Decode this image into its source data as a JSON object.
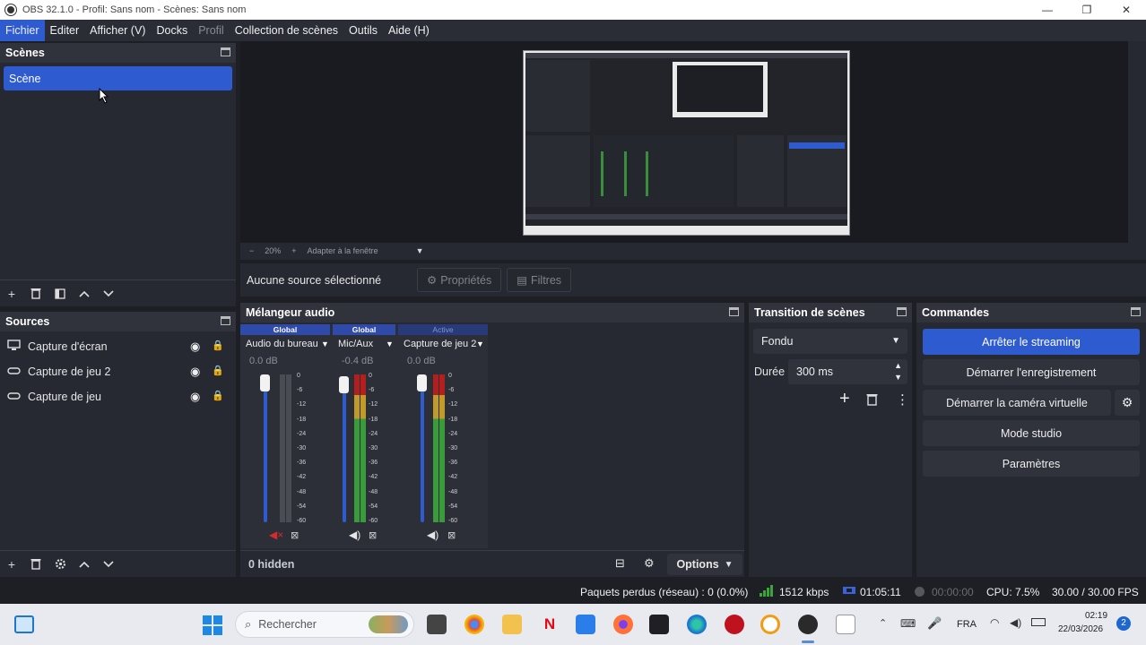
{
  "window": {
    "title": "OBS 32.1.0 - Profil: Sans nom - Scènes: Sans nom",
    "minimize": "—",
    "maximize": "❐",
    "close": "✕"
  },
  "menu": [
    "Fichier",
    "Editer",
    "Afficher (V)",
    "Docks",
    "Profil",
    "Collection de scènes",
    "Outils",
    "Aide (H)"
  ],
  "scenes": {
    "title": "Scènes",
    "items": [
      "Scène"
    ]
  },
  "sources": {
    "title": "Sources",
    "items": [
      {
        "label": "Capture d'écran",
        "icon": "monitor-icon"
      },
      {
        "label": "Capture de jeu 2",
        "icon": "gamepad-icon"
      },
      {
        "label": "Capture de jeu",
        "icon": "gamepad-icon"
      }
    ]
  },
  "preview": {
    "zoom": "20%",
    "fit": "Adapter à la fenêtre"
  },
  "context": {
    "no_source": "Aucune source sélectionné",
    "properties": "Propriétés",
    "filters": "Filtres"
  },
  "mixer": {
    "title": "Mélangeur audio",
    "channels": [
      {
        "badge": "Global",
        "name": "Audio du bureau",
        "db": "0.0 dB",
        "volume": 1.0,
        "muted": true
      },
      {
        "badge": "Global",
        "name": "Mic/Aux",
        "db": "-0.4 dB",
        "volume": 0.99,
        "muted": false
      },
      {
        "badge": "Active",
        "name": "Capture de jeu 2",
        "db": "0.0 dB",
        "volume": 1.0,
        "muted": false
      }
    ],
    "scale": [
      "0",
      "-6",
      "-12",
      "-18",
      "-24",
      "-30",
      "-36",
      "-42",
      "-48",
      "-54",
      "-60"
    ],
    "hidden": "0 hidden",
    "options": "Options"
  },
  "transitions": {
    "title": "Transition de scènes",
    "type": "Fondu",
    "duration_label": "Durée",
    "duration": "300 ms"
  },
  "controls": {
    "title": "Commandes",
    "buttons": [
      "Arrêter le streaming",
      "Démarrer l'enregistrement",
      "Démarrer la caméra virtuelle",
      "Mode studio",
      "Paramètres"
    ]
  },
  "status": {
    "dropped": "Paquets perdus (réseau) : 0 (0.0%)",
    "bitrate": "1512 kbps",
    "stream_time": "01:05:11",
    "rec_time": "00:00:00",
    "cpu": "CPU: 7.5%",
    "fps": "30.00 / 30.00 FPS"
  },
  "taskbar": {
    "search": "Rechercher",
    "lang": "FRA",
    "time": "02:19",
    "date": "22/03/2026",
    "notif": "2"
  },
  "colors": {
    "accent": "#2f5bd1",
    "panel": "#272932",
    "bg": "#1e1f25",
    "mute_red": "#d62b2b"
  }
}
